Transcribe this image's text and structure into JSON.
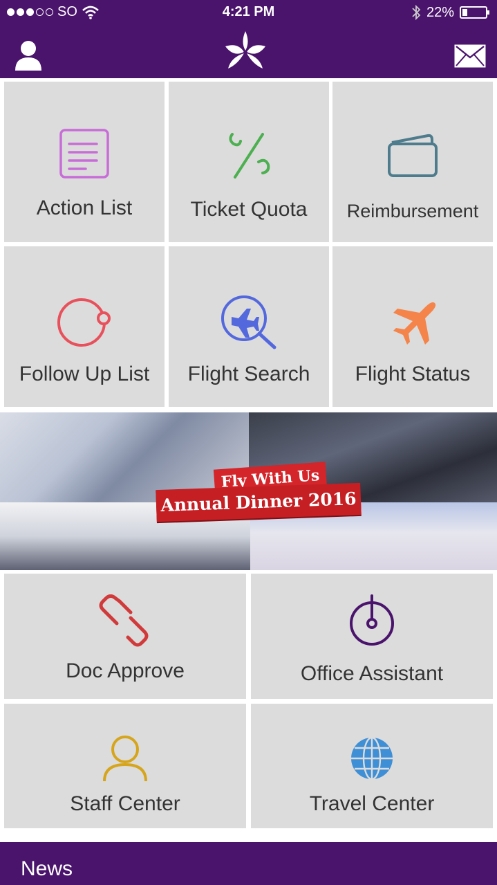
{
  "status_bar": {
    "carrier": "SO",
    "time": "4:21 PM",
    "battery": "22%",
    "battery_level": 0.22,
    "signal_bars_filled": 3,
    "signal_bars_total": 5,
    "icons": [
      "wifi-icon",
      "bluetooth-icon",
      "battery-icon"
    ]
  },
  "header": {
    "icons": [
      "user-icon",
      "orchid-logo",
      "mail-icon"
    ],
    "background": "#4a136c"
  },
  "tiles": [
    {
      "label": "Action List",
      "icon": "document-list-icon",
      "color": "#c86dd7"
    },
    {
      "label": "Ticket Quota",
      "icon": "percent-icon",
      "color": "#4caf50"
    },
    {
      "label": "Reimbursement",
      "icon": "wallet-icon",
      "color": "#4e7c8c"
    },
    {
      "label": "Follow Up List",
      "icon": "follow-up-circle-icon",
      "color": "#e8505b"
    },
    {
      "label": "Flight Search",
      "icon": "flight-search-icon",
      "color": "#5468dd"
    },
    {
      "label": "Flight Status",
      "icon": "airplane-icon",
      "color": "#f4844a"
    },
    {
      "label": "Doc Approve",
      "icon": "link-chain-icon",
      "color": "#d13a3a"
    },
    {
      "label": "Office Assistant",
      "icon": "power-dial-icon",
      "color": "#4a136c"
    },
    {
      "label": "Staff Center",
      "icon": "person-icon",
      "color": "#d6a51c"
    },
    {
      "label": "Travel Center",
      "icon": "globe-icon",
      "color": "#3f8fd6"
    }
  ],
  "banner": {
    "line1": "Fly With Us",
    "line2": "Annual Dinner 2016",
    "accent": "#c51f24"
  },
  "news": {
    "label": "News"
  }
}
